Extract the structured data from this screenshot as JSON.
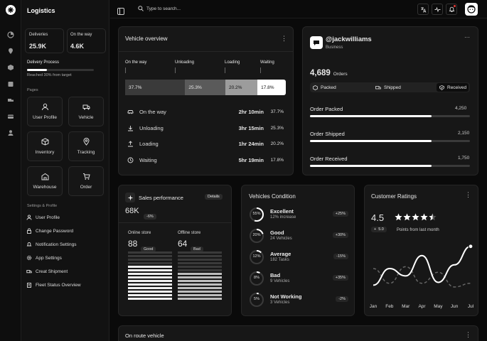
{
  "sidebar": {
    "title": "Logistics",
    "stats": [
      {
        "label": "Deliveries",
        "value": "25.9K"
      },
      {
        "label": "On the way",
        "value": "4.6K"
      }
    ],
    "process": {
      "label": "Delivery Process",
      "note": "Reached 30% from target",
      "progress": 0.3
    },
    "pages_heading": "Pages",
    "pages": [
      "User Profile",
      "Vehicle",
      "Inventory",
      "Tracking",
      "Warehouse",
      "Order"
    ],
    "settings_heading": "Settings & Profile",
    "settings": [
      "User Profile",
      "Change Password",
      "Notification Settings",
      "App Settings",
      "Creat Shipment",
      "Fleet Status Overview"
    ]
  },
  "topbar": {
    "search_placeholder": "Type to search..."
  },
  "vehicle_overview": {
    "title": "Vehicle overview",
    "headers": [
      "On the way",
      "Unloading",
      "Loading",
      "Waiting"
    ],
    "segments": [
      "37.7%",
      "25.3%",
      "20.2%",
      "17.8%"
    ],
    "segment_values": [
      37.7,
      25.3,
      20.2,
      17.8
    ],
    "rows": [
      {
        "label": "On the way",
        "time": "2hr 10min",
        "pct": "37.7%"
      },
      {
        "label": "Unloading",
        "time": "3hr 15min",
        "pct": "25.3%"
      },
      {
        "label": "Loading",
        "time": "1hr 24min",
        "pct": "20.2%"
      },
      {
        "label": "Waiting",
        "time": "5hr 19min",
        "pct": "17.8%"
      }
    ]
  },
  "profile": {
    "handle": "@jackwilliams",
    "type": "Business",
    "orders_count": "4,689",
    "orders_label": "Orders",
    "tabs": [
      "Packed",
      "Shipped",
      "Received"
    ],
    "bars": [
      {
        "label": "Order Packed",
        "value": "4,250",
        "fraction": 0.76
      },
      {
        "label": "Order Shipped",
        "value": "2,150",
        "fraction": 0.76
      },
      {
        "label": "Order Received",
        "value": "1,750",
        "fraction": 0.76
      }
    ]
  },
  "sales": {
    "title": "Sales performance",
    "details": "Details",
    "total": "68K",
    "change": "-6%",
    "online": {
      "label": "Online store",
      "value": "88",
      "badge": "Good"
    },
    "offline": {
      "label": "Offline store",
      "value": "64",
      "badge": "Bad"
    }
  },
  "vehicles_condition": {
    "title": "Vehicles Condition",
    "items": [
      {
        "pct": "55%",
        "frac": 0.55,
        "name": "Excellent",
        "sub": "12% increase",
        "badge": "+25%"
      },
      {
        "pct": "20%",
        "frac": 0.2,
        "name": "Good",
        "sub": "24 Vehicles",
        "badge": "+30%"
      },
      {
        "pct": "12%",
        "frac": 0.12,
        "name": "Average",
        "sub": "182 Tasks",
        "badge": "-15%"
      },
      {
        "pct": "8%",
        "frac": 0.08,
        "name": "Bad",
        "sub": "9 Vehicles",
        "badge": "+35%"
      },
      {
        "pct": "5%",
        "frac": 0.05,
        "name": "Not Working",
        "sub": "3 Vehicles",
        "badge": "-2%"
      }
    ]
  },
  "ratings": {
    "title": "Customer Ratings",
    "score": "4.5",
    "change": "5.0",
    "note": "Points from last month",
    "stars": 4.5
  },
  "chart_data": {
    "type": "line",
    "categories": [
      "Jan",
      "Feb",
      "Mar",
      "Apr",
      "May",
      "Jun",
      "Jul"
    ],
    "series": [
      {
        "values": [
          1.2,
          3.0,
          2.2,
          4.4,
          1.5,
          3.4,
          5.4
        ]
      },
      {
        "values": [
          3.0,
          1.4,
          3.2,
          1.4,
          2.6,
          1.0,
          1.4
        ]
      }
    ],
    "ylim": [
      0,
      6
    ]
  },
  "on_route": {
    "title": "On route vehicle"
  },
  "colors": {
    "accent": "#ffffff",
    "bg": "#0a0a0a",
    "card": "#171717"
  }
}
